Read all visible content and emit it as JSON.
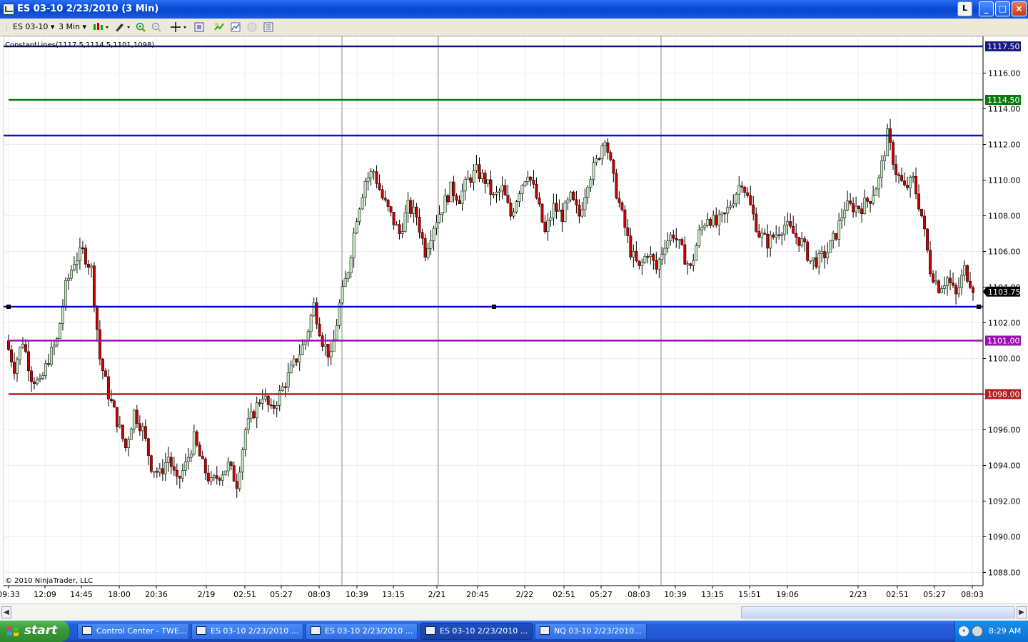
{
  "window": {
    "title": "ES 03-10  2/23/2010 (3 Min)",
    "buttons": {
      "l": "L",
      "minimize": "_",
      "maximize": "□",
      "close": "×"
    }
  },
  "toolbar": {
    "instrument": "ES 03-10",
    "interval": "3 Min",
    "dropdown_glyph": "▾",
    "icons": [
      "bar-style-icon",
      "draw-pencil-icon",
      "zoom-in-icon",
      "zoom-out-icon",
      "crosshair-icon",
      "data-box-icon",
      "indicators-icon",
      "strategies-icon",
      "sound-icon",
      "properties-icon"
    ]
  },
  "chart": {
    "indicator_label": "ConstantLines(1117.5,1114.5,1101,1098)",
    "copyright": "© 2010 NinjaTrader, LLC",
    "current_price": "1103.75",
    "y_ticks": [
      "1116.00",
      "1114.00",
      "1112.00",
      "1110.00",
      "1108.00",
      "1106.00",
      "1104.00",
      "1102.00",
      "1100.00",
      "1098.00",
      "1096.00",
      "1094.00",
      "1092.00",
      "1090.00",
      "1088.00"
    ],
    "x_ticks": [
      "09:33",
      "12:09",
      "14:45",
      "18:00",
      "20:36",
      "2/19",
      "02:51",
      "05:27",
      "08:03",
      "10:39",
      "13:15",
      "2/21",
      "20:45",
      "2/22",
      "02:51",
      "05:27",
      "08:03",
      "10:39",
      "13:15",
      "15:51",
      "19:06",
      "2/23",
      "02:51",
      "05:27",
      "08:03"
    ],
    "constant_lines": [
      {
        "value": "1117.50",
        "color": "#1a1a80"
      },
      {
        "value": "1114.50",
        "color": "#0a7a0a"
      },
      {
        "value": "1101.00",
        "color": "#9a10b0"
      },
      {
        "value": "1098.00",
        "color": "#b02020"
      }
    ],
    "drawn_lines": [
      {
        "value": "1112.50",
        "color": "#1010d0"
      },
      {
        "value": "1102.90",
        "color": "#0808c8"
      }
    ],
    "colors": {
      "up": "#bde8bd",
      "down": "#cc0000",
      "wick": "#000000",
      "grid": "#ededed",
      "session": "#888888"
    }
  },
  "chart_data": {
    "type": "candlestick",
    "title": "ES 03-10  2/23/2010 (3 Min)",
    "ylim": [
      1087.5,
      1118.5
    ],
    "x_labels": [
      "09:33",
      "12:09",
      "14:45",
      "18:00",
      "20:36",
      "2/19",
      "02:51",
      "05:27",
      "08:03",
      "10:39",
      "13:15",
      "2/21",
      "20:45",
      "2/22",
      "02:51",
      "05:27",
      "08:03",
      "10:39",
      "13:15",
      "15:51",
      "19:06",
      "2/23",
      "02:51",
      "05:27",
      "08:03"
    ],
    "close_path": [
      1101,
      1099.5,
      1101,
      1099,
      1098.5,
      1100,
      1101,
      1104,
      1105.5,
      1106,
      1105,
      1100,
      1098,
      1096.5,
      1095,
      1097,
      1096,
      1094,
      1093.5,
      1094.5,
      1093,
      1094,
      1095.5,
      1094,
      1093,
      1093.5,
      1094,
      1093,
      1096,
      1097,
      1098,
      1097,
      1098,
      1099,
      1100,
      1101,
      1103,
      1101,
      1100,
      1103,
      1105,
      1108,
      1110,
      1110.5,
      1109,
      1108,
      1107,
      1108.5,
      1108,
      1106,
      1107.5,
      1108.5,
      1109.5,
      1109,
      1110,
      1110.5,
      1110,
      1109,
      1109.5,
      1108,
      1109.5,
      1110.5,
      1109,
      1107,
      1108.5,
      1108,
      1109,
      1108,
      1110,
      1111,
      1112.5,
      1110,
      1108,
      1106,
      1105,
      1106,
      1105,
      1106.5,
      1107,
      1106,
      1105,
      1107,
      1108,
      1107.5,
      1108,
      1109,
      1110,
      1108.5,
      1107,
      1106.5,
      1107,
      1107.5,
      1107,
      1106.5,
      1105.5,
      1105.5,
      1106,
      1107,
      1108.5,
      1108.5,
      1108.5,
      1109,
      1110,
      1112.5,
      1110.5,
      1109.5,
      1110,
      1108,
      1105,
      1104,
      1104.5,
      1103.5,
      1105,
      1104
    ],
    "constant_lines": [
      1117.5,
      1114.5,
      1101,
      1098
    ],
    "last_price": 1103.75
  }
}
